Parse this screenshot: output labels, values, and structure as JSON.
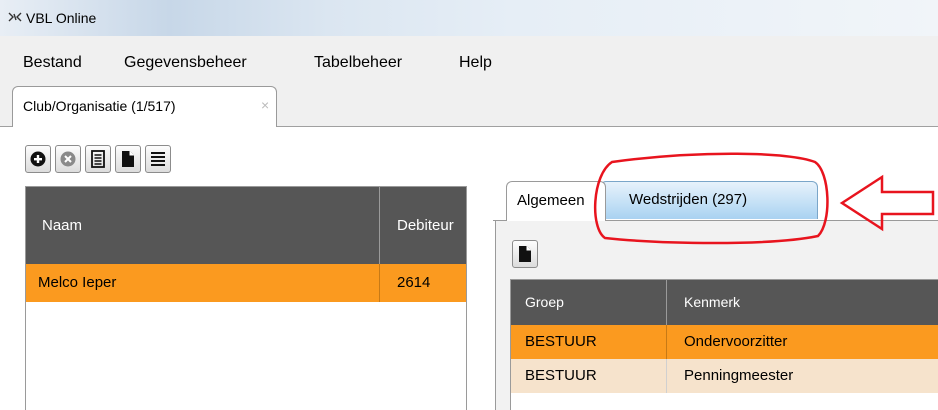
{
  "window": {
    "title": "VBL Online"
  },
  "menu": {
    "items": [
      "Bestand",
      "Gegevensbeheer",
      "Tabelbeheer",
      "Help"
    ]
  },
  "doc_tab": {
    "label": "Club/Organisatie (1/517)",
    "close_glyph": "×"
  },
  "left_grid": {
    "columns": [
      "Naam",
      "Debiteur"
    ],
    "rows": [
      {
        "naam": "Melco Ieper",
        "debiteur": "2614"
      }
    ]
  },
  "right_panel": {
    "tabs": [
      "Algemeen",
      "Wedstrijden (297)"
    ],
    "grid": {
      "columns": [
        "Groep",
        "Kenmerk"
      ],
      "rows": [
        {
          "groep": "BESTUUR",
          "kenmerk": "Ondervoorzitter"
        },
        {
          "groep": "BESTUUR",
          "kenmerk": "Penningmeester"
        }
      ]
    }
  },
  "colors": {
    "selected_row": "#fb9a1f",
    "alt_row": "#f6e3cc",
    "header_bg": "#565656",
    "annotation_red": "#e8141e"
  },
  "icons": {
    "toolbar": [
      "add-icon",
      "delete-icon",
      "details-icon",
      "document-icon",
      "list-icon"
    ],
    "right_toolbar": [
      "document-icon"
    ]
  }
}
